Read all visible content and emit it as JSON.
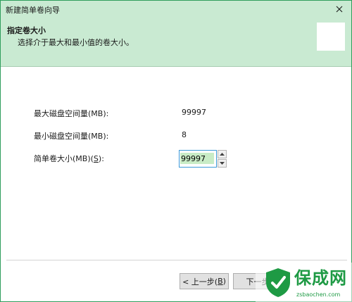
{
  "window": {
    "title": "新建简单卷向导"
  },
  "header": {
    "title": "指定卷大小",
    "description": "选择介于最大和最小值的卷大小。"
  },
  "fields": {
    "max_label": "最大磁盘空间量(MB):",
    "max_value": "99997",
    "min_label": "最小磁盘空间量(MB):",
    "min_value": "8",
    "size_label_prefix": "简单卷大小(MB)(",
    "size_label_key": "S",
    "size_label_suffix": "):",
    "size_value": "99997"
  },
  "buttons": {
    "back_prefix": "< 上一步(",
    "back_key": "B",
    "back_suffix": ")",
    "next_label": "下一步"
  },
  "watermark": {
    "text": "保成网",
    "url": "zsbaochen.com"
  },
  "colors": {
    "header_bg": "#c9ead2",
    "selection": "#c8ecc6",
    "watermark": "#1e9a44"
  },
  "icons": [
    "close-icon",
    "spin-up-icon",
    "spin-down-icon",
    "shield-icon"
  ]
}
